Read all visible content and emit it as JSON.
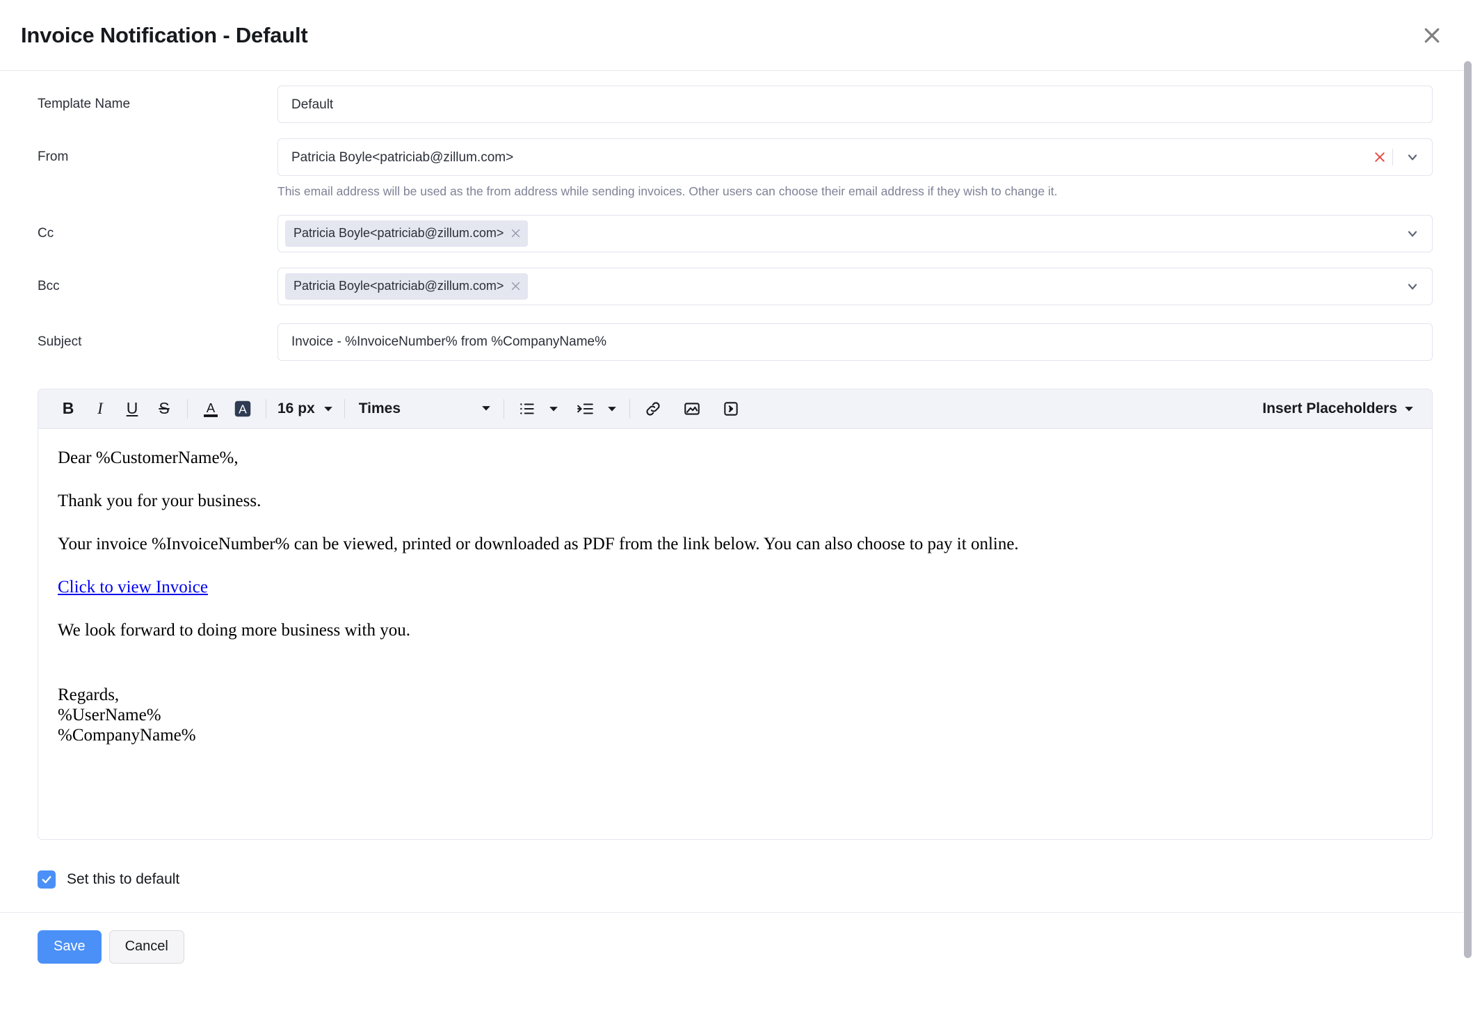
{
  "header": {
    "title": "Invoice Notification - Default",
    "close_icon": "close-icon"
  },
  "form": {
    "template_name": {
      "label": "Template Name",
      "value": "Default"
    },
    "from": {
      "label": "From",
      "value": "Patricia Boyle<patriciab@zillum.com>",
      "clear_icon": "clear-x-icon",
      "dropdown_icon": "chevron-down-icon",
      "help": "This email address will be used as the from address while sending invoices. Other users can choose their email address if they wish to change it."
    },
    "cc": {
      "label": "Cc",
      "chips": [
        "Patricia Boyle<patriciab@zillum.com>"
      ],
      "chip_remove_icon": "chip-remove-icon",
      "dropdown_icon": "chevron-down-icon"
    },
    "bcc": {
      "label": "Bcc",
      "chips": [
        "Patricia Boyle<patriciab@zillum.com>"
      ],
      "chip_remove_icon": "chip-remove-icon",
      "dropdown_icon": "chevron-down-icon"
    },
    "subject": {
      "label": "Subject",
      "value": "Invoice - %InvoiceNumber% from %CompanyName%"
    }
  },
  "editor": {
    "toolbar": {
      "bold": "B",
      "italic": "I",
      "underline": "U",
      "strikethrough": "S",
      "text_color_icon": "text-color-icon",
      "highlight_color_icon": "highlight-color-icon",
      "font_size": "16 px",
      "font_family": "Times",
      "bullet_list_icon": "bullet-list-icon",
      "indent_icon": "indent-icon",
      "link_icon": "link-icon",
      "image_icon": "image-icon",
      "source_code_icon": "source-code-icon",
      "insert_placeholders": "Insert Placeholders",
      "insert_placeholders_caret": "caret-down-icon"
    },
    "body": {
      "greeting": "Dear %CustomerName%,",
      "line_thanks": "Thank you for your business.",
      "line_invoice": "Your invoice %InvoiceNumber% can be viewed, printed or downloaded as PDF from the link below. You can also choose to pay it online.",
      "link_text": "Click to view Invoice",
      "line_closing": "We look forward to doing more business with you.",
      "sign_regards": "Regards,",
      "sign_user": "%UserName%",
      "sign_company": "%CompanyName%"
    }
  },
  "footer": {
    "set_default_label": "Set this to default",
    "set_default_checked": true,
    "check_icon": "check-icon",
    "save_label": "Save",
    "cancel_label": "Cancel"
  },
  "colors": {
    "primary": "#4a90f7",
    "toolbar_bg": "#f1f3f8",
    "chip_bg": "#e4e6f0",
    "link": "#0000ee",
    "clear_x": "#e8473f",
    "border": "#e3e4ed",
    "help_text": "#7d8295"
  }
}
